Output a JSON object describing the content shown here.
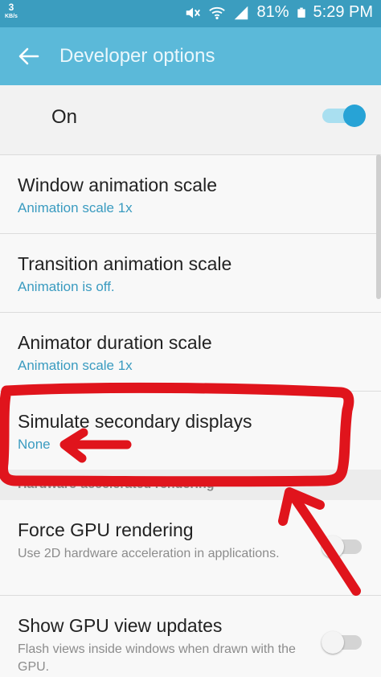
{
  "status_bar": {
    "speed": "3",
    "speed_unit": "KB/s",
    "battery": "81%",
    "time": "5:29 PM",
    "icons": [
      "mute-icon",
      "wifi-icon",
      "signal-icon",
      "battery-icon"
    ]
  },
  "app_bar": {
    "title": "Developer options",
    "back_icon": "arrow-left-icon"
  },
  "master_switch": {
    "label": "On",
    "state": "on"
  },
  "settings": [
    {
      "title": "Window animation scale",
      "subtitle": "Animation scale 1x"
    },
    {
      "title": "Transition animation scale",
      "subtitle": "Animation is off."
    },
    {
      "title": "Animator duration scale",
      "subtitle": "Animation scale 1x"
    },
    {
      "title": "Simulate secondary displays",
      "subtitle": "None"
    }
  ],
  "section": {
    "header": "Hardware-accelerated rendering"
  },
  "hardware_settings": [
    {
      "title": "Force GPU rendering",
      "description": "Use 2D hardware acceleration in applications.",
      "state": "off"
    },
    {
      "title": "Show GPU view updates",
      "description": "Flash views inside windows when drawn with the GPU.",
      "state": "off"
    }
  ],
  "colors": {
    "status_bar": "#3b9dbf",
    "app_bar": "#5bb9d9",
    "accent": "#27a3d6",
    "subtitle": "#3a9bc0",
    "annotation": "#e0141c"
  }
}
